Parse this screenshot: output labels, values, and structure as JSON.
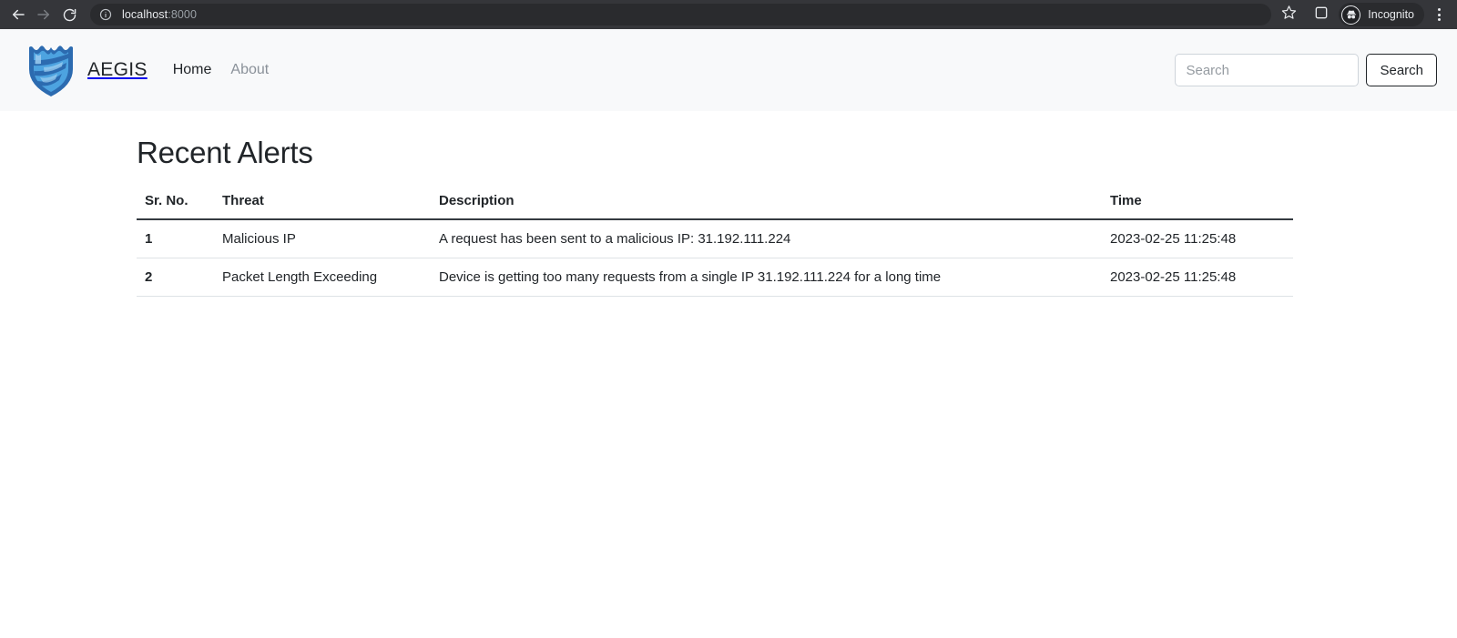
{
  "browser": {
    "back_icon": "back-arrow-icon",
    "forward_icon": "forward-arrow-icon",
    "reload_icon": "reload-icon",
    "site_info_icon": "info-circle-icon",
    "url_host": "localhost",
    "url_port": ":8000",
    "bookmark_icon": "star-icon",
    "side_panel_icon": "side-panel-icon",
    "profile_label": "Incognito",
    "profile_icon": "incognito-avatar-icon",
    "menu_icon": "three-dot-menu-icon"
  },
  "navbar": {
    "logo_icon": "aegis-shield-logo-icon",
    "brand": "AEGIS",
    "links": [
      {
        "label": "Home",
        "active": true
      },
      {
        "label": "About",
        "active": false
      }
    ],
    "search": {
      "placeholder": "Search",
      "value": "",
      "button_label": "Search"
    }
  },
  "main": {
    "title": "Recent Alerts",
    "table": {
      "columns": [
        "Sr. No.",
        "Threat",
        "Description",
        "Time"
      ],
      "rows": [
        {
          "sr_no": "1",
          "threat": "Malicious IP",
          "description": "A request has been sent to a malicious IP: 31.192.111.224",
          "time": "2023-02-25 11:25:48"
        },
        {
          "sr_no": "2",
          "threat": "Packet Length Exceeding",
          "description": "Device is getting too many requests from a single IP 31.192.111.224 for a long time",
          "time": "2023-02-25 11:25:48"
        }
      ]
    }
  },
  "colors": {
    "chrome_bg": "#35363a",
    "omnibox_bg": "#2a2b2e",
    "navbar_bg": "#f8f9fa",
    "brand_blue_dark": "#2c6bb0",
    "brand_blue_light": "#4da3e0",
    "text": "#212529",
    "muted": "#8a9199",
    "border": "#dee2e6"
  }
}
